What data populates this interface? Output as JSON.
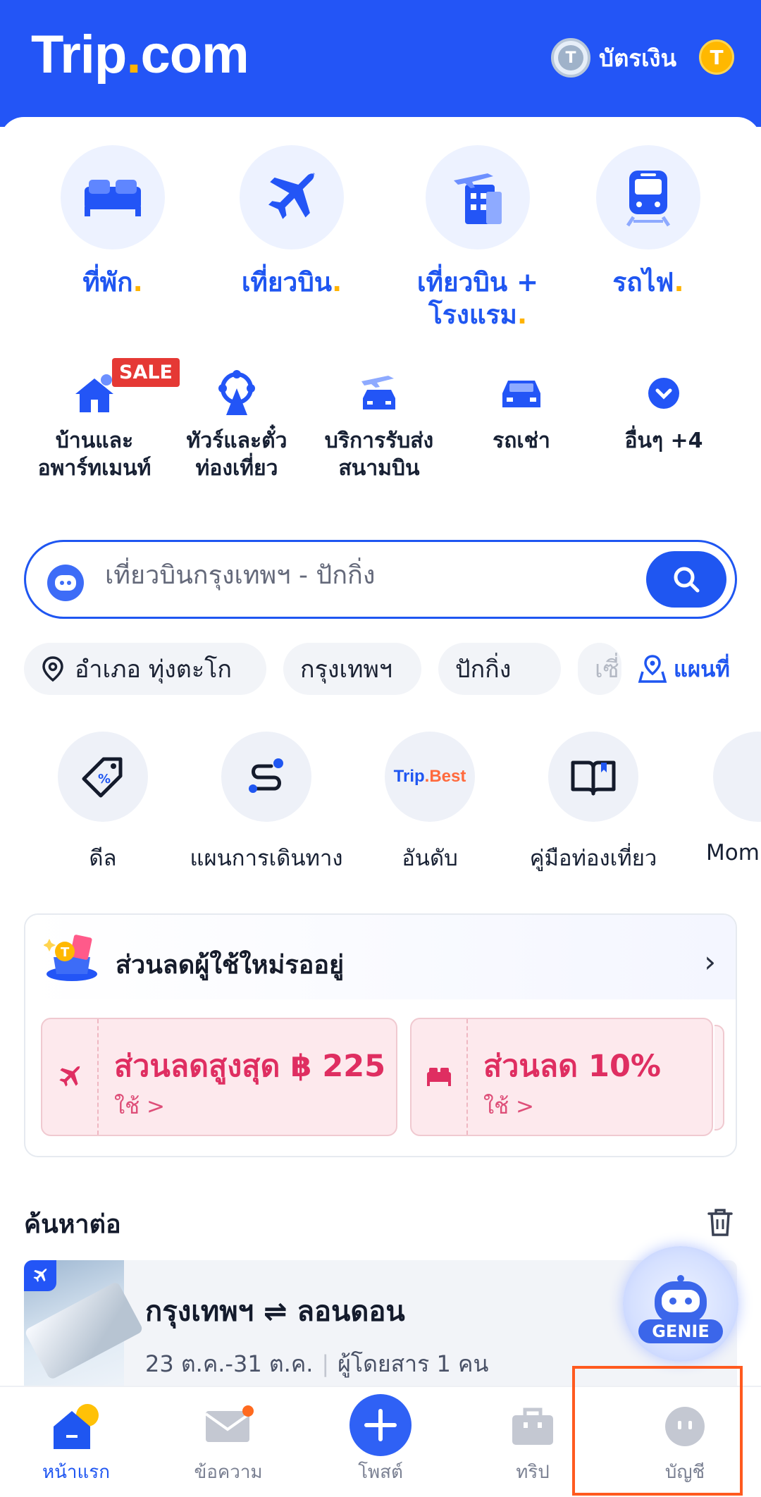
{
  "header": {
    "logo_main": "Trip",
    "logo_dot": ".",
    "logo_tail": "com",
    "card_label": "บัตรเงิน",
    "card_badge": "T",
    "coin": "T",
    "colors": {
      "brand": "#2355f6",
      "accent": "#ffb300"
    }
  },
  "main_services": [
    {
      "label": "ที่พัก",
      "icon": "bed-icon"
    },
    {
      "label": "เที่ยวบิน",
      "icon": "plane-icon"
    },
    {
      "label": "เที่ยวบิน +",
      "label2": "โรงแรม",
      "icon": "flight-hotel-icon"
    },
    {
      "label": "รถไฟ",
      "icon": "train-icon"
    }
  ],
  "secondary_services": [
    {
      "line1": "บ้านและ",
      "line2": "อพาร์ทเมนท์",
      "badge": "SALE",
      "icon": "house-icon"
    },
    {
      "line1": "ทัวร์และตั๋ว",
      "line2": "ท่องเที่ยว",
      "icon": "ferris-wheel-icon"
    },
    {
      "line1": "บริการรับส่ง",
      "line2": "สนามบิน",
      "icon": "airport-transfer-icon"
    },
    {
      "line1": "รถเช่า",
      "line2": "",
      "icon": "car-icon"
    },
    {
      "line1": "อื่นๆ +4",
      "line2": "",
      "icon": "chevron-down-icon"
    }
  ],
  "search": {
    "placeholder": "เที่ยวบินกรุงเทพฯ - ปักกิ่ง"
  },
  "chips": [
    "อำเภอ ทุ่งตะโก",
    "กรุงเทพฯ",
    "ปักกิ่ง",
    "เซี่"
  ],
  "map_link": "แผนที่",
  "tools": [
    {
      "label": "ดีล",
      "icon": "tag-icon"
    },
    {
      "label": "แผนการเดินทาง",
      "icon": "route-icon"
    },
    {
      "label": "อันดับ",
      "icon": "trip-best-icon",
      "logo_a": "Trip",
      "logo_b": ".Best"
    },
    {
      "label": "คู่มือท่องเที่ยว",
      "icon": "book-icon"
    },
    {
      "label": "Mom",
      "icon": "moments-icon"
    }
  ],
  "promo": {
    "title": "ส่วนลดผู้ใช้ใหม่รออยู่",
    "coupons": [
      {
        "amount": "ส่วนลดสูงสุด ฿ 225",
        "use": "ใช้ >",
        "icon": "plane-icon"
      },
      {
        "amount": "ส่วนลด 10%",
        "use": "ใช้ >",
        "icon": "bed-icon"
      }
    ]
  },
  "recent": {
    "title": "ค้นหาต่อ",
    "route": "กรุงเทพฯ ⇌ ลอนดอน",
    "dates": "23 ต.ค.-31 ต.ค.",
    "passengers": "ผู้โดยสาร 1 คน"
  },
  "genie": {
    "label": "GENIE"
  },
  "tabbar": [
    {
      "label": "หน้าแรก",
      "icon": "home-icon",
      "active": true
    },
    {
      "label": "ข้อความ",
      "icon": "mail-icon"
    },
    {
      "label": "โพสต์",
      "icon": "plus-icon"
    },
    {
      "label": "ทริป",
      "icon": "suitcase-icon"
    },
    {
      "label": "บัญชี",
      "icon": "account-icon"
    }
  ]
}
